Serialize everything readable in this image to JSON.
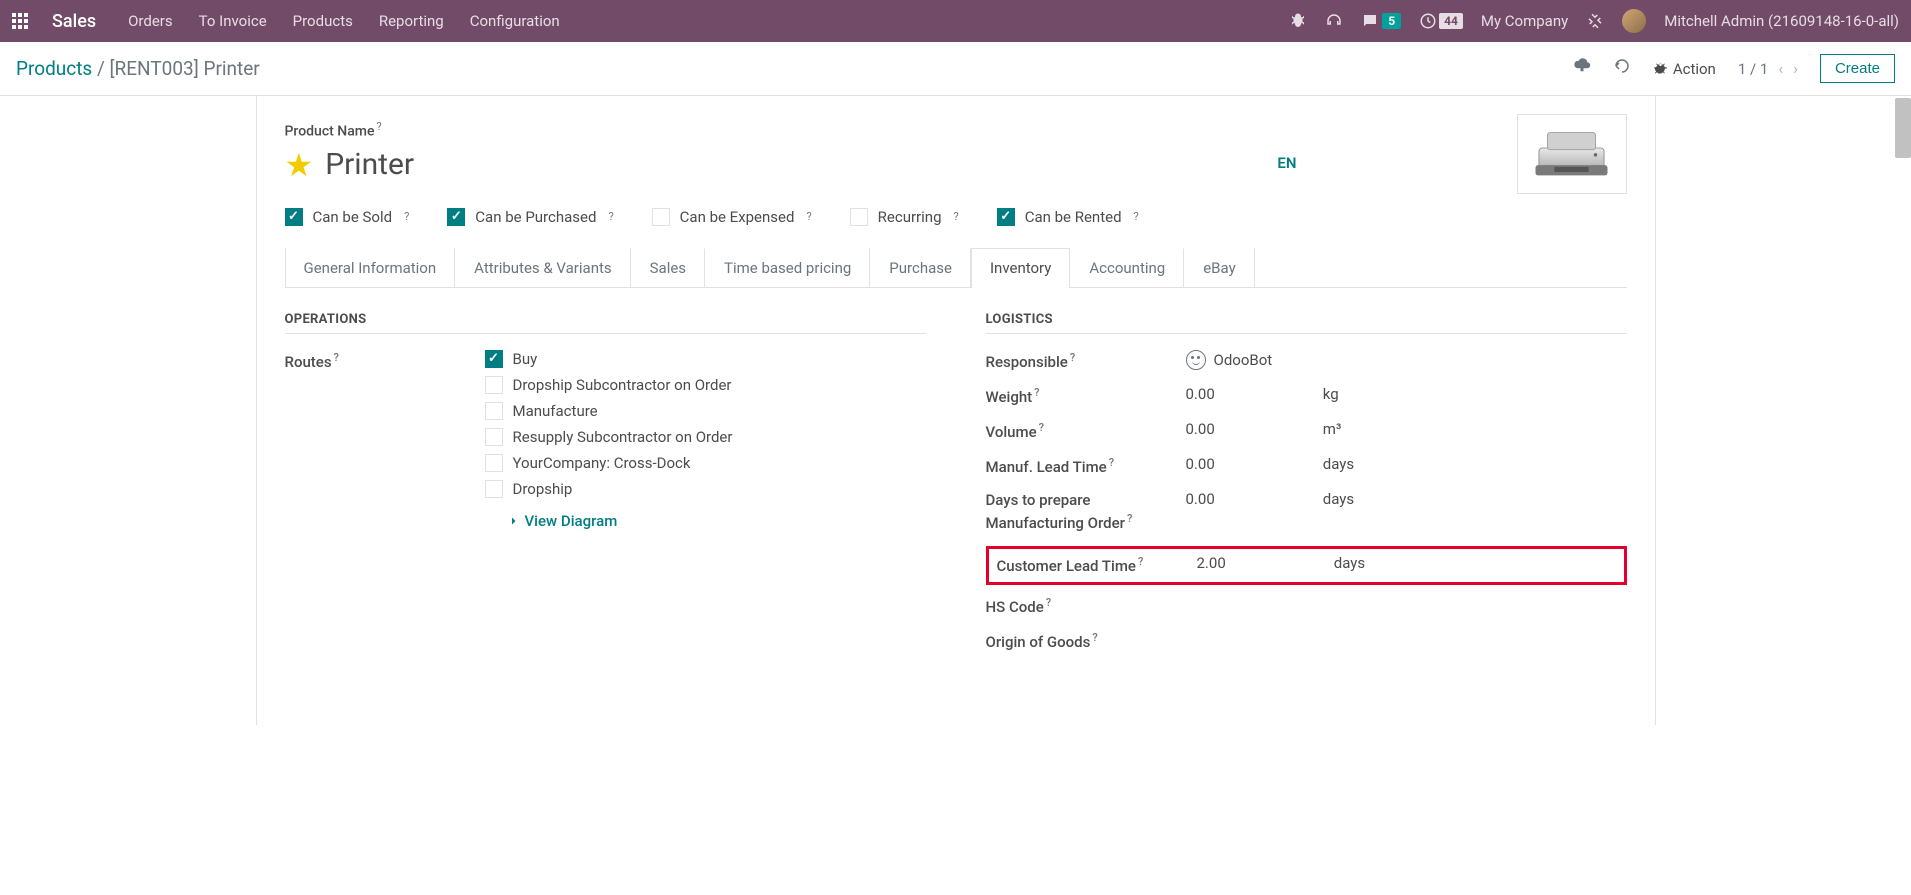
{
  "navbar": {
    "brand": "Sales",
    "menu": [
      "Orders",
      "To Invoice",
      "Products",
      "Reporting",
      "Configuration"
    ],
    "msg_badge": "5",
    "clock_badge": "44",
    "company": "My Company",
    "user": "Mitchell Admin (21609148-16-0-all)"
  },
  "control_panel": {
    "breadcrumb_root": "Products",
    "breadcrumb_current": "[RENT003] Printer",
    "action_label": "Action",
    "pager": "1 / 1",
    "create_label": "Create"
  },
  "form": {
    "title_label": "Product Name",
    "title": "Printer",
    "lang": "EN",
    "checkboxes": [
      {
        "label": "Can be Sold",
        "checked": true
      },
      {
        "label": "Can be Purchased",
        "checked": true
      },
      {
        "label": "Can be Expensed",
        "checked": false
      },
      {
        "label": "Recurring",
        "checked": false
      },
      {
        "label": "Can be Rented",
        "checked": true
      }
    ],
    "tabs": [
      "General Information",
      "Attributes & Variants",
      "Sales",
      "Time based pricing",
      "Purchase",
      "Inventory",
      "Accounting",
      "eBay"
    ],
    "active_tab": 5,
    "operations": {
      "title": "OPERATIONS",
      "routes_label": "Routes",
      "routes": [
        {
          "label": "Buy",
          "checked": true
        },
        {
          "label": "Dropship Subcontractor on Order",
          "checked": false
        },
        {
          "label": "Manufacture",
          "checked": false
        },
        {
          "label": "Resupply Subcontractor on Order",
          "checked": false
        },
        {
          "label": "YourCompany: Cross-Dock",
          "checked": false
        },
        {
          "label": "Dropship",
          "checked": false
        }
      ],
      "view_diagram": "View Diagram"
    },
    "logistics": {
      "title": "LOGISTICS",
      "responsible_label": "Responsible",
      "responsible_value": "OdooBot",
      "weight_label": "Weight",
      "weight_value": "0.00",
      "weight_unit": "kg",
      "volume_label": "Volume",
      "volume_value": "0.00",
      "volume_unit": "m³",
      "manuf_label": "Manuf. Lead Time",
      "manuf_value": "0.00",
      "manuf_unit": "days",
      "prep_label": "Days to prepare Manufacturing Order",
      "prep_value": "0.00",
      "prep_unit": "days",
      "cust_label": "Customer Lead Time",
      "cust_value": "2.00",
      "cust_unit": "days",
      "hs_label": "HS Code",
      "origin_label": "Origin of Goods"
    }
  }
}
